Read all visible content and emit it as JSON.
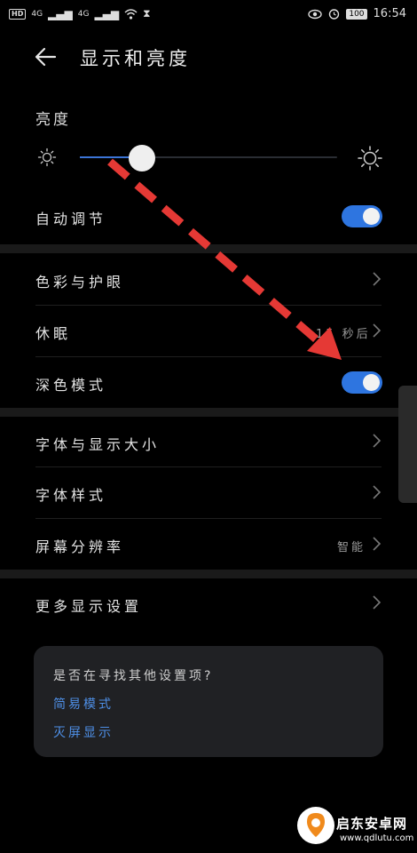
{
  "status_bar": {
    "left_badges": [
      "HD",
      "4G",
      "4G"
    ],
    "battery": "100",
    "time": "16:54"
  },
  "header": {
    "title": "显示和亮度"
  },
  "brightness": {
    "label": "亮度",
    "level_fraction": 0.24
  },
  "rows": {
    "auto_adjust": {
      "label": "自动调节",
      "on": true
    },
    "color_eye": {
      "label": "色彩与护眼"
    },
    "sleep": {
      "label": "休眠",
      "value": "15 秒后"
    },
    "dark_mode": {
      "label": "深色模式",
      "on": true
    },
    "font_size": {
      "label": "字体与显示大小"
    },
    "font_style": {
      "label": "字体样式"
    },
    "resolution": {
      "label": "屏幕分辨率",
      "value": "智能"
    },
    "more_display": {
      "label": "更多显示设置"
    }
  },
  "suggestion_card": {
    "question": "是否在寻找其他设置项?",
    "links": [
      "简易模式",
      "灭屏显示"
    ]
  },
  "watermark": {
    "name": "启东安卓网",
    "url": "www.qdlutu.com"
  },
  "colors": {
    "accent": "#2e75e0",
    "link": "#4e8fe6",
    "annotation_arrow": "#e53935"
  }
}
